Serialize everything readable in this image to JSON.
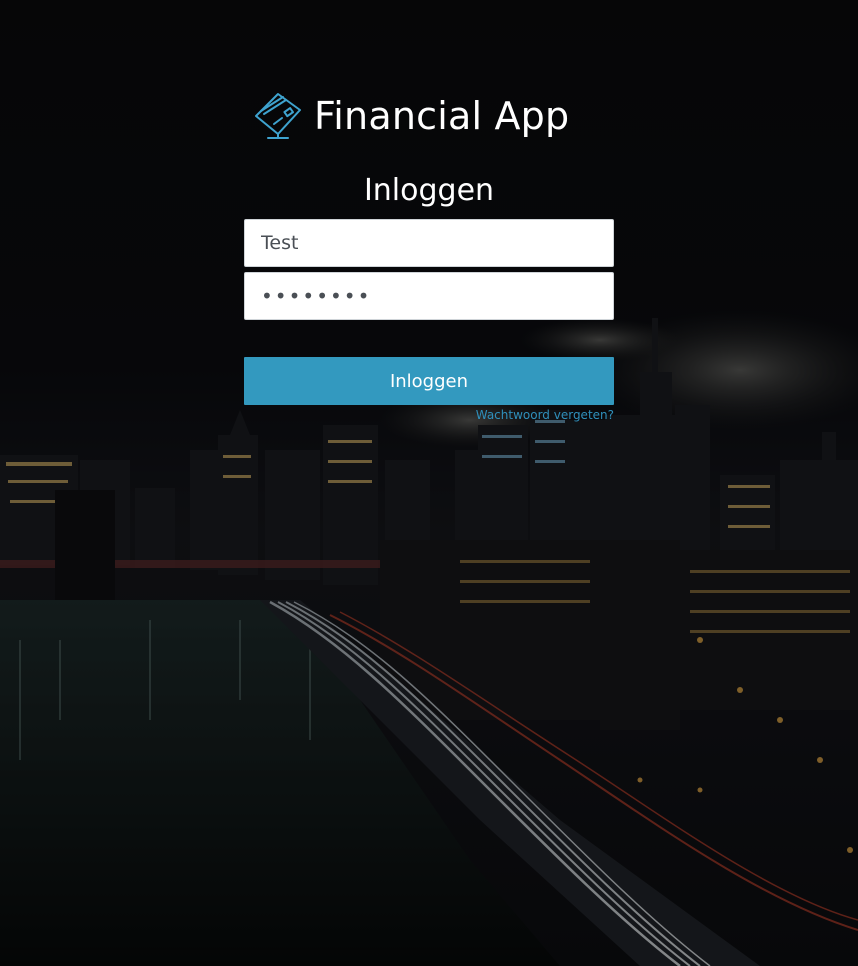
{
  "app": {
    "title": "Financial App",
    "icon": "credit-card-icon",
    "accent_color": "#3399bf"
  },
  "login": {
    "heading": "Inloggen",
    "username_value": "Test",
    "password_value": "12345678",
    "submit_label": "Inloggen",
    "forgot_link": "Wachtwoord vergeten?"
  },
  "background": {
    "icon": "night-city-skyline-image"
  }
}
